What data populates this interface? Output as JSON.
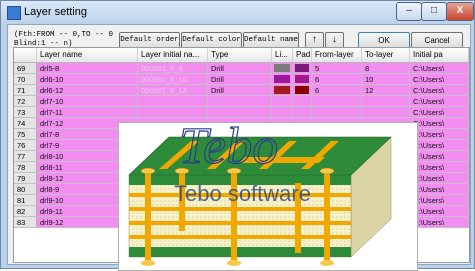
{
  "window": {
    "title": "Layer setting",
    "minimize": "–",
    "maximize": "□",
    "close": "X"
  },
  "hint": {
    "line1": "(Fth:FROM -- 0,TO -- 0",
    "line2": "Blind:1 -- n)"
  },
  "buttons": {
    "default_order": "Default order",
    "default_color": "Default color",
    "default_name": "Default name",
    "up": "🡅",
    "down": "🡇",
    "ok": "OK",
    "cancel": "Cancel"
  },
  "table": {
    "columns": [
      "",
      "Layer name",
      "Layer initial na...",
      "Type",
      "Li...",
      "Pad",
      "From-layer",
      "To-layer",
      "Initial pa"
    ],
    "rows": [
      {
        "num": "69",
        "name": "drl5-8",
        "initial": "000001_5_8",
        "type": "Drill",
        "li_color": "#7b7b7b",
        "pad_color": "#7b1a7b",
        "from": "5",
        "to": "8",
        "path": "C:\\Users\\"
      },
      {
        "num": "70",
        "name": "drl6-10",
        "initial": "000001_6_10",
        "type": "Drill",
        "li_color": "#9a1a9a",
        "pad_color": "#a01a8c",
        "from": "6",
        "to": "10",
        "path": "C:\\Users\\"
      },
      {
        "num": "71",
        "name": "drl6-12",
        "initial": "000001_6_12",
        "type": "Drill",
        "li_color": "#a31a1a",
        "pad_color": "#8b0000",
        "from": "6",
        "to": "12",
        "path": "C:\\Users\\"
      },
      {
        "num": "72",
        "name": "drl7-10",
        "path": "C:\\Users\\"
      },
      {
        "num": "73",
        "name": "drl7-11",
        "path": "C:\\Users\\"
      },
      {
        "num": "74",
        "name": "drl7-12",
        "path": "C:\\Users\\"
      },
      {
        "num": "75",
        "name": "drl7-8",
        "path": "C:\\Users\\"
      },
      {
        "num": "76",
        "name": "drl7-9",
        "path": "C:\\Users\\"
      },
      {
        "num": "77",
        "name": "drl8-10",
        "path": "C:\\Users\\"
      },
      {
        "num": "78",
        "name": "drl8-11",
        "path": "C:\\Users\\"
      },
      {
        "num": "79",
        "name": "drl8-12",
        "path": "C:\\Users\\"
      },
      {
        "num": "80",
        "name": "drl8-9",
        "path": "C:\\Users\\"
      },
      {
        "num": "81",
        "name": "drl9-10",
        "path": "C:\\Users\\"
      },
      {
        "num": "82",
        "name": "drl9-11",
        "path": "C:\\Users\\"
      },
      {
        "num": "83",
        "name": "drl9-12",
        "path": "C:\\Users\\"
      }
    ]
  },
  "watermark": {
    "logo_text": "Tebo",
    "caption": "Tebo software"
  },
  "colors": {
    "row_highlight": "#f28ef1",
    "board_green": "#2e8b3a",
    "copper_gold": "#f0a800"
  }
}
